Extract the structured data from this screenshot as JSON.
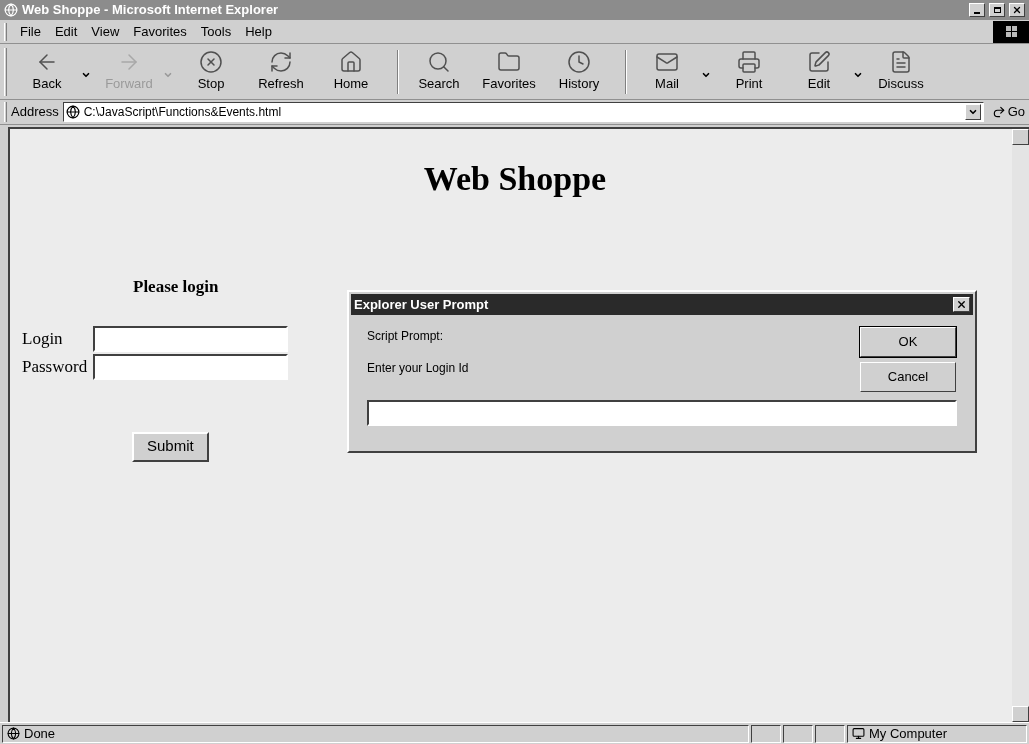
{
  "window": {
    "title": "Web Shoppe - Microsoft Internet Explorer"
  },
  "menu": [
    "File",
    "Edit",
    "View",
    "Favorites",
    "Tools",
    "Help"
  ],
  "toolbar": [
    {
      "label": "Back",
      "disabled": false,
      "dropdown": true
    },
    {
      "label": "Forward",
      "disabled": true,
      "dropdown": true
    },
    {
      "label": "Stop",
      "disabled": false,
      "dropdown": false
    },
    {
      "label": "Refresh",
      "disabled": false,
      "dropdown": false
    },
    {
      "label": "Home",
      "disabled": false,
      "dropdown": false
    },
    {
      "label": "Search",
      "disabled": false,
      "dropdown": false
    },
    {
      "label": "Favorites",
      "disabled": false,
      "dropdown": false
    },
    {
      "label": "History",
      "disabled": false,
      "dropdown": false
    },
    {
      "label": "Mail",
      "disabled": false,
      "dropdown": true
    },
    {
      "label": "Print",
      "disabled": false,
      "dropdown": false
    },
    {
      "label": "Edit",
      "disabled": false,
      "dropdown": true
    },
    {
      "label": "Discuss",
      "disabled": false,
      "dropdown": false
    }
  ],
  "address": {
    "label": "Address",
    "value": "C:\\JavaScript\\Functions&Events.html",
    "go": "Go"
  },
  "page": {
    "heading": "Web Shoppe",
    "subheading": "Please login",
    "fields": [
      {
        "label": "Login"
      },
      {
        "label": "Password"
      }
    ],
    "submit": "Submit"
  },
  "dialog": {
    "title": "Explorer User Prompt",
    "caption": "Script Prompt:",
    "message": "Enter your Login Id",
    "buttons": [
      "OK",
      "Cancel"
    ]
  },
  "status_bar": {
    "text": "Done",
    "zone": "My Computer"
  }
}
